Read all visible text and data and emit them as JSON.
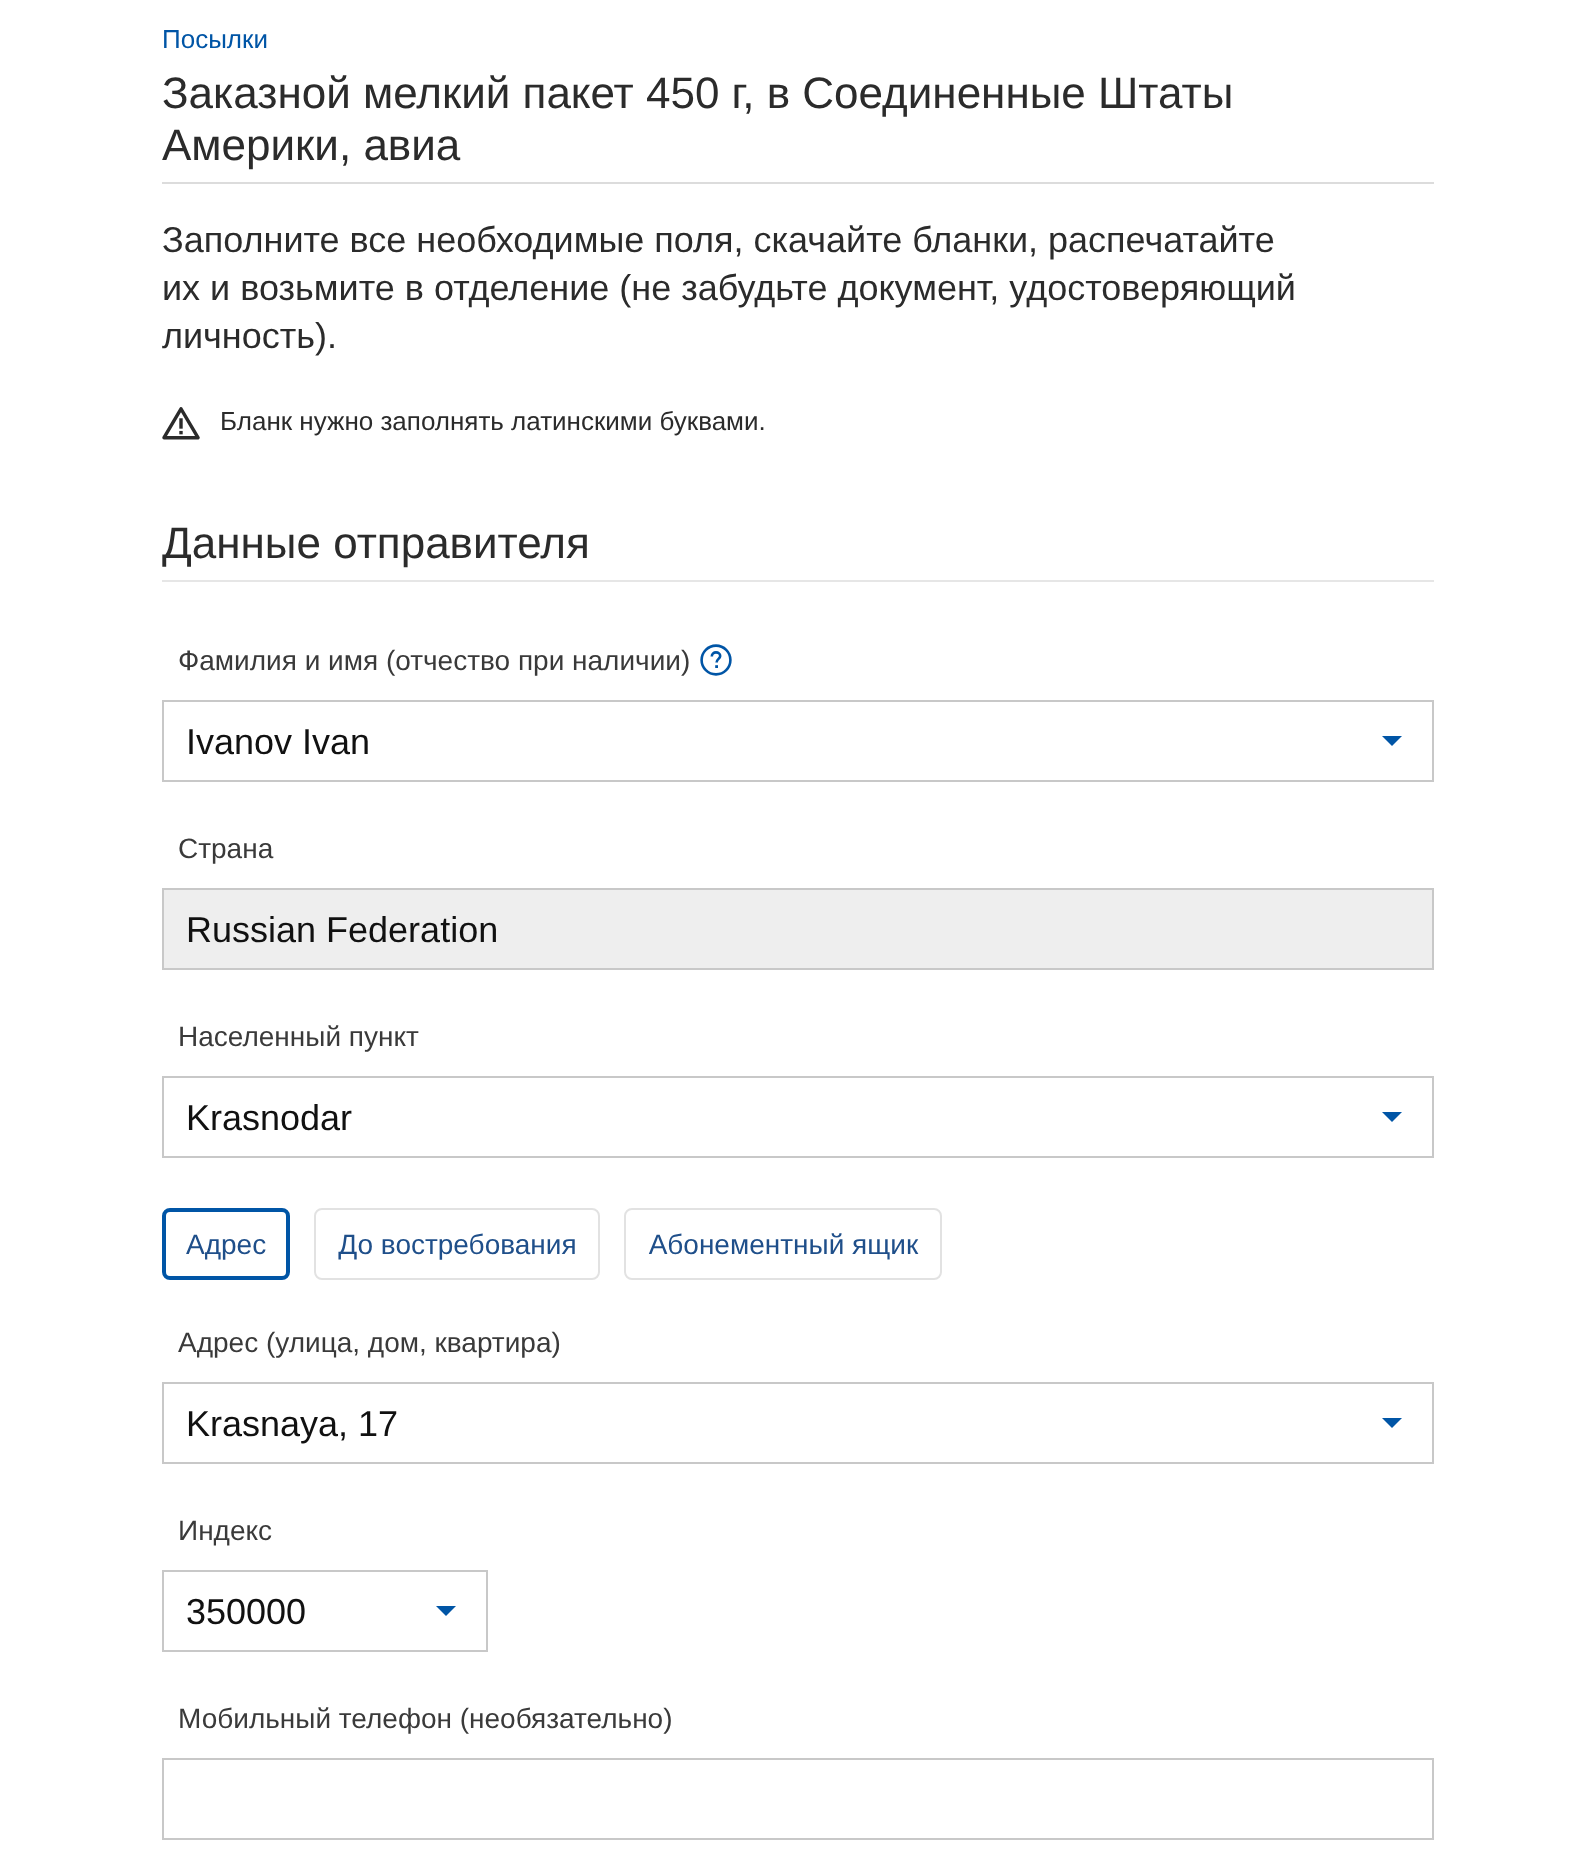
{
  "breadcrumb": "Посылки",
  "title": "Заказной мелкий пакет 450 г, в Соединенные Штаты Америки, авиа",
  "intro": "Заполните все необходимые поля, скачайте бланки, распечатайте их и возьмите в отделение (не забудьте документ, удостоверяющий личность).",
  "warning": "Бланк нужно заполнять латинскими буквами.",
  "section": {
    "title": "Данные отправителя",
    "items": [
      {
        "kind": "select",
        "label": "Фамилия и имя (отчество при наличии)",
        "help": true,
        "value": "Ivanov Ivan"
      },
      {
        "kind": "readonly",
        "label": "Страна",
        "value": "Russian Federation"
      },
      {
        "kind": "select",
        "label": "Населенный пункт",
        "value": "Krasnodar"
      },
      {
        "kind": "segmented",
        "options": [
          {
            "label": "Адрес",
            "selected": true
          },
          {
            "label": "До востребования",
            "selected": false
          },
          {
            "label": "Абонементный ящик",
            "selected": false
          }
        ]
      },
      {
        "kind": "select",
        "label": "Адрес (улица, дом, квартира)",
        "value": "Krasnaya, 17"
      },
      {
        "kind": "shortselect",
        "label": "Индекс",
        "value": "350000"
      },
      {
        "kind": "input",
        "label": "Мобильный телефон (необязательно)"
      }
    ]
  }
}
